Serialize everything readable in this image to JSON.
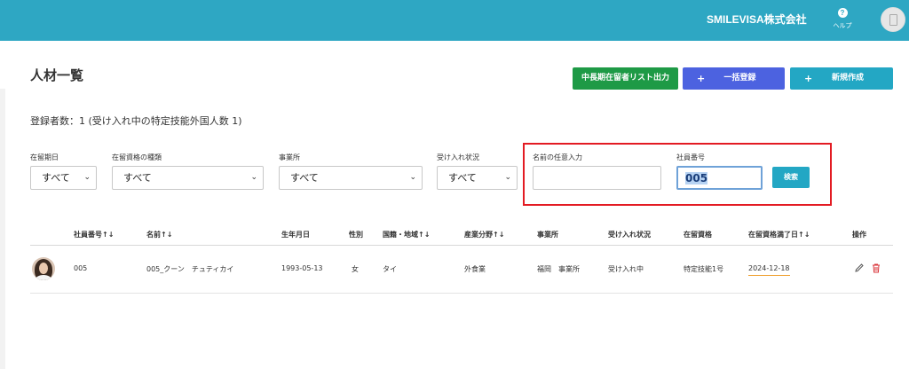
{
  "header": {
    "company": "SMILEVISA株式会社",
    "help_label": "ヘルプ",
    "help_icon": "?"
  },
  "page": {
    "title": "人材一覧",
    "count_text": "登録者数：1 (受け入れ中の特定技能外国人数 1)"
  },
  "actions": {
    "export_label": "中長期在留者リスト出力",
    "bulk_label": "一括登録",
    "new_label": "新規作成",
    "plus": "+"
  },
  "filters": {
    "stay_period": {
      "label": "在留期日",
      "value": "すべて"
    },
    "status_type": {
      "label": "在留資格の種類",
      "value": "すべて"
    },
    "office": {
      "label": "事業所",
      "value": "すべて"
    },
    "acceptance": {
      "label": "受け入れ状況",
      "value": "すべて"
    },
    "name_search": {
      "label": "名前の任意入力",
      "value": ""
    },
    "employee_no": {
      "label": "社員番号",
      "value": "005"
    },
    "search_label": "検索"
  },
  "table": {
    "headers": {
      "employee_no": "社員番号↑↓",
      "name": "名前↑↓",
      "birth": "生年月日",
      "gender": "性別",
      "nationality": "国籍・地域↑↓",
      "industry": "産業分野↑↓",
      "office": "事業所",
      "acceptance": "受け入れ状況",
      "status": "在留資格",
      "expiry": "在留資格満了日↑↓",
      "ops": "操作"
    },
    "rows": [
      {
        "employee_no": "005",
        "name": "005_クーン　チュティカイ",
        "birth": "1993-05-13",
        "gender": "女",
        "nationality": "タイ",
        "industry": "外食業",
        "office": "福岡　事業所",
        "acceptance": "受け入れ中",
        "status": "特定技能1号",
        "expiry": "2024-12-18"
      }
    ]
  },
  "colors": {
    "topbar": "#2ea7c3",
    "export": "#1e9a46",
    "bulk": "#4c62e0",
    "new": "#23a7c4",
    "highlight_border": "#e31b23",
    "delete": "#d9343a"
  },
  "icons": {
    "edit": "pencil-icon",
    "delete": "trash-icon",
    "chevron": "chevron-down-icon"
  }
}
